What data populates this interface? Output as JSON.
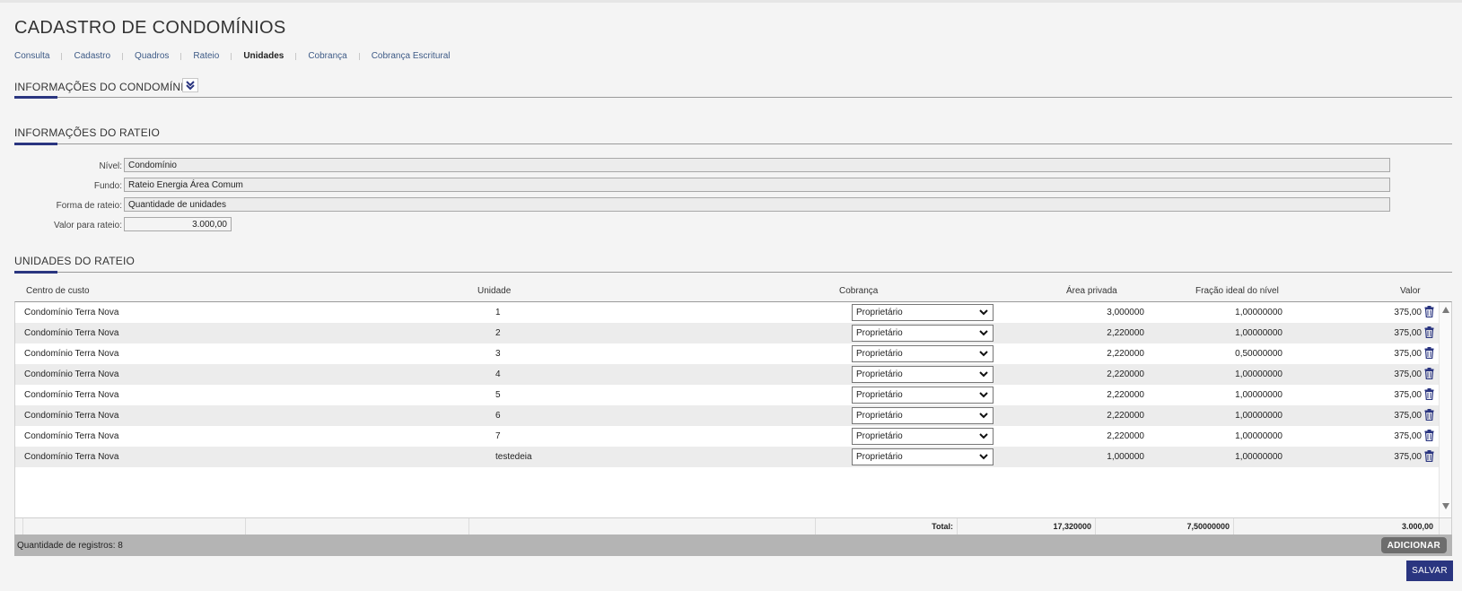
{
  "page": {
    "title": "CADASTRO DE CONDOMÍNIOS"
  },
  "tabs": [
    {
      "label": "Consulta"
    },
    {
      "label": "Cadastro"
    },
    {
      "label": "Quadros"
    },
    {
      "label": "Rateio"
    },
    {
      "label": "Unidades",
      "active": true
    },
    {
      "label": "Cobrança"
    },
    {
      "label": "Cobrança Escritural"
    }
  ],
  "sections": {
    "condominio": "INFORMAÇÕES DO CONDOMÍNIO",
    "rateio": "INFORMAÇÕES DO RATEIO",
    "unidades": "UNIDADES DO RATEIO"
  },
  "rateio": {
    "nivel_label": "Nível:",
    "nivel_value": "Condomínio",
    "fundo_label": "Fundo:",
    "fundo_value": "Rateio Energia Área Comum",
    "forma_label": "Forma de rateio:",
    "forma_value": "Quantidade de unidades",
    "valor_label": "Valor para rateio:",
    "valor_value": "3.000,00"
  },
  "grid": {
    "headers": {
      "centro": "Centro de custo",
      "unidade": "Unidade",
      "cobranca": "Cobrança",
      "area": "Área privada",
      "fracao": "Fração ideal do nível",
      "valor": "Valor"
    },
    "rows": [
      {
        "centro": "Condomínio Terra Nova",
        "unidade": "1",
        "cobranca": "Proprietário",
        "area": "3,000000",
        "fracao": "1,00000000",
        "valor": "375,00"
      },
      {
        "centro": "Condomínio Terra Nova",
        "unidade": "2",
        "cobranca": "Proprietário",
        "area": "2,220000",
        "fracao": "1,00000000",
        "valor": "375,00"
      },
      {
        "centro": "Condomínio Terra Nova",
        "unidade": "3",
        "cobranca": "Proprietário",
        "area": "2,220000",
        "fracao": "0,50000000",
        "valor": "375,00"
      },
      {
        "centro": "Condomínio Terra Nova",
        "unidade": "4",
        "cobranca": "Proprietário",
        "area": "2,220000",
        "fracao": "1,00000000",
        "valor": "375,00"
      },
      {
        "centro": "Condomínio Terra Nova",
        "unidade": "5",
        "cobranca": "Proprietário",
        "area": "2,220000",
        "fracao": "1,00000000",
        "valor": "375,00"
      },
      {
        "centro": "Condomínio Terra Nova",
        "unidade": "6",
        "cobranca": "Proprietário",
        "area": "2,220000",
        "fracao": "1,00000000",
        "valor": "375,00"
      },
      {
        "centro": "Condomínio Terra Nova",
        "unidade": "7",
        "cobranca": "Proprietário",
        "area": "2,220000",
        "fracao": "1,00000000",
        "valor": "375,00"
      },
      {
        "centro": "Condomínio Terra Nova",
        "unidade": "testedeia",
        "cobranca": "Proprietário",
        "area": "1,000000",
        "fracao": "1,00000000",
        "valor": "375,00"
      }
    ],
    "totals": {
      "label": "Total:",
      "area": "17,320000",
      "fracao": "7,50000000",
      "valor": "3.000,00"
    },
    "record_count": "Quantidade de registros: 8"
  },
  "buttons": {
    "add": "ADICIONAR",
    "save": "SALVAR"
  },
  "colors": {
    "accent": "#2a3580",
    "link": "#3d5a86"
  },
  "icons": {
    "expand": "double-chevron-down-icon",
    "delete": "trash-icon",
    "scroll_up": "triangle-up-icon",
    "scroll_down": "triangle-down-icon",
    "dropdown": "chevron-down-icon"
  }
}
